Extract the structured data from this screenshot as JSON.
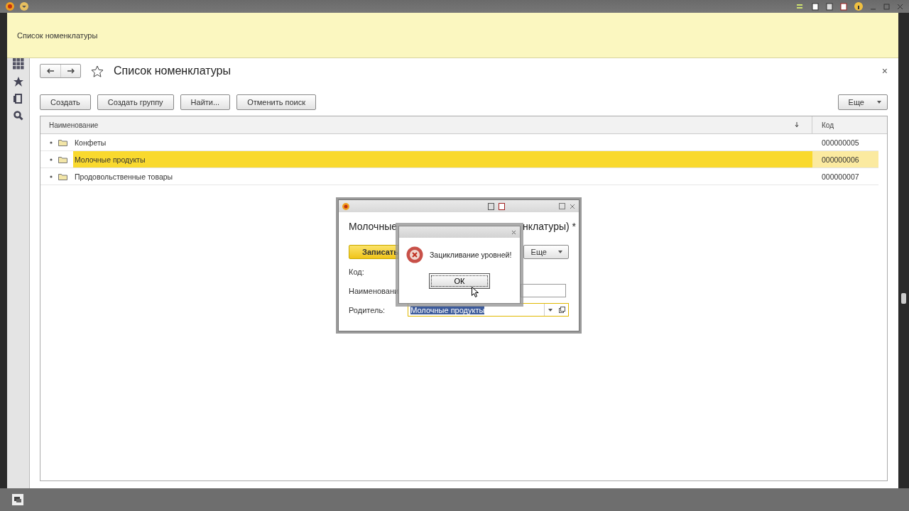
{
  "header": {
    "title": "Список номенклатуры"
  },
  "form": {
    "title": "Список номенклатуры",
    "favorite": false,
    "close": "×"
  },
  "toolbar": {
    "buttons": [
      "Создать",
      "Создать группу",
      "Найти...",
      "Отменить поиск"
    ],
    "more": "Еще"
  },
  "table": {
    "columns": [
      "Наименование",
      "Код"
    ],
    "rows": [
      {
        "name": "Конфеты",
        "code": "000000005",
        "selected": false
      },
      {
        "name": "Молочные продукты",
        "code": "000000006",
        "selected": true
      },
      {
        "name": "Продовольственные товары",
        "code": "000000007",
        "selected": false
      }
    ]
  },
  "dialog": {
    "heading_start": "Молочные",
    "heading_end": "нклатуры) *",
    "save": "Записать",
    "more": "Еще",
    "code_label": "Код:",
    "name_label": "Наименовани",
    "parent_label": "Родитель:",
    "parent_value": "Молочные продукты"
  },
  "alert": {
    "message": "Зацикливание уровней!",
    "button": "ОК"
  }
}
